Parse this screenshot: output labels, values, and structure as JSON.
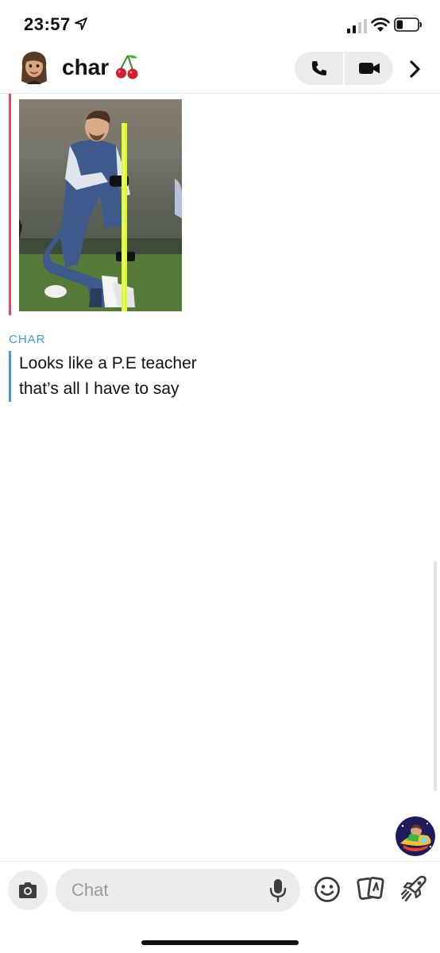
{
  "status_bar": {
    "time": "23:57",
    "location_icon": "location-arrow-icon",
    "signal_icon": "cellular-signal-icon",
    "wifi_icon": "wifi-icon",
    "battery_icon": "battery-icon",
    "battery_level": 0.3
  },
  "header": {
    "name": "char",
    "emoji_icon": "cherry-icon",
    "avatar_icon": "bitmoji-avatar-icon",
    "phone_icon": "phone-icon",
    "video_icon": "video-camera-icon",
    "more_icon": "chevron-right-icon"
  },
  "messages": [
    {
      "type": "image",
      "from": "me",
      "description_icon": "photo-icon",
      "accent": "#e04a5f"
    },
    {
      "type": "text",
      "sender": "CHAR",
      "lines": [
        "Looks like a P.E teacher",
        "that’s all I have to say"
      ],
      "accent": "#3a9be8"
    }
  ],
  "composer": {
    "placeholder": "Chat",
    "camera_icon": "camera-icon",
    "mic_icon": "microphone-icon",
    "sticker_icon": "smiley-icon",
    "cards_icon": "cards-icon",
    "games_icon": "rocket-icon",
    "bitmoji_icon": "bitmoji-rocket-icon"
  },
  "colors": {
    "my_accent": "#e04a5f",
    "their_accent": "#3a9be8",
    "pill_bg": "#ececee"
  }
}
